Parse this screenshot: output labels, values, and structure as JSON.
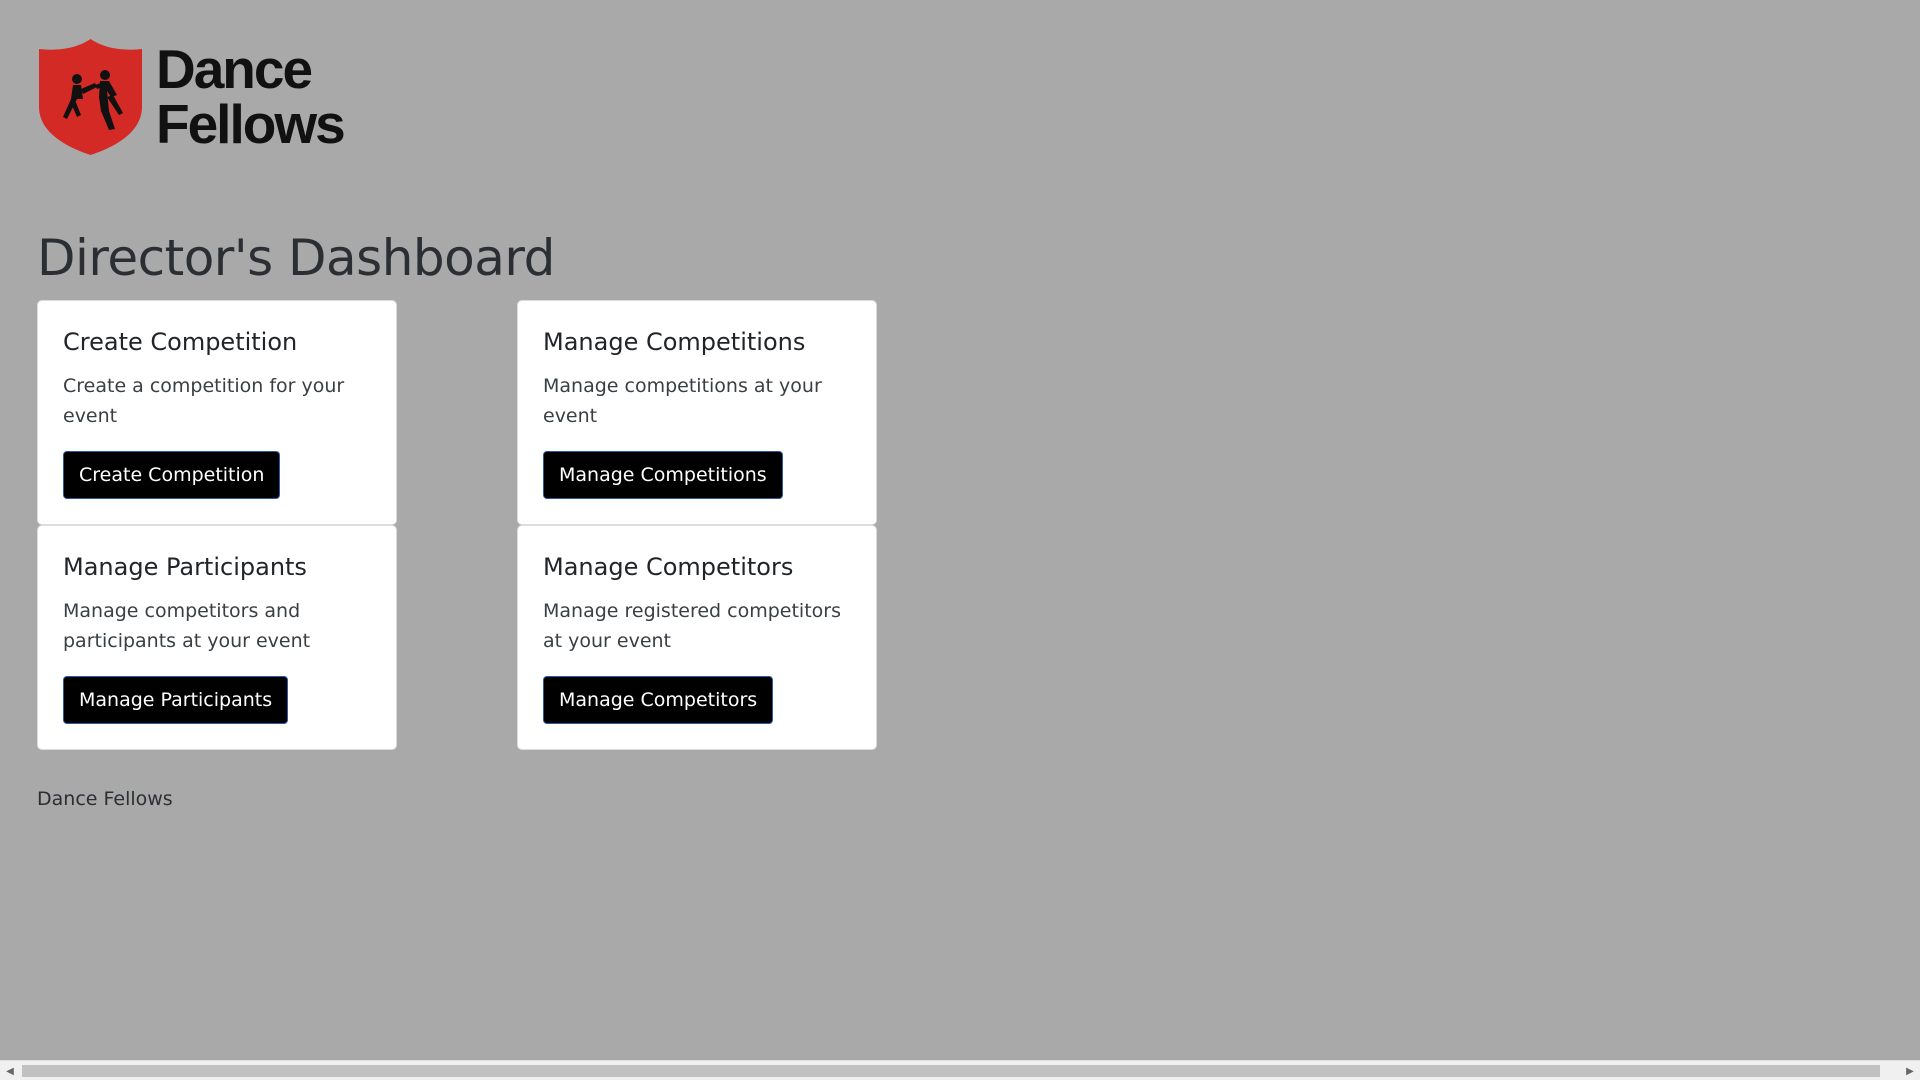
{
  "logo": {
    "line1": "Dance",
    "line2": "Fellows",
    "shield_color": "#d42a25"
  },
  "page_title": "Director's Dashboard",
  "cards": [
    {
      "title": "Create Competition",
      "text": "Create a competition for your event",
      "button": "Create Competition"
    },
    {
      "title": "Manage Competitions",
      "text": "Manage competitions at your event",
      "button": "Manage Competitions"
    },
    {
      "title": "Manage Participants",
      "text": "Manage competitors and participants at your event",
      "button": "Manage Participants"
    },
    {
      "title": "Manage Competitors",
      "text": "Manage registered competitors at your event",
      "button": "Manage Competitors"
    }
  ],
  "footer": {
    "text": "Dance Fellows"
  },
  "scrollbar": {
    "left_arrow_icon": "triangle-left-icon",
    "right_arrow_icon": "triangle-right-icon"
  }
}
